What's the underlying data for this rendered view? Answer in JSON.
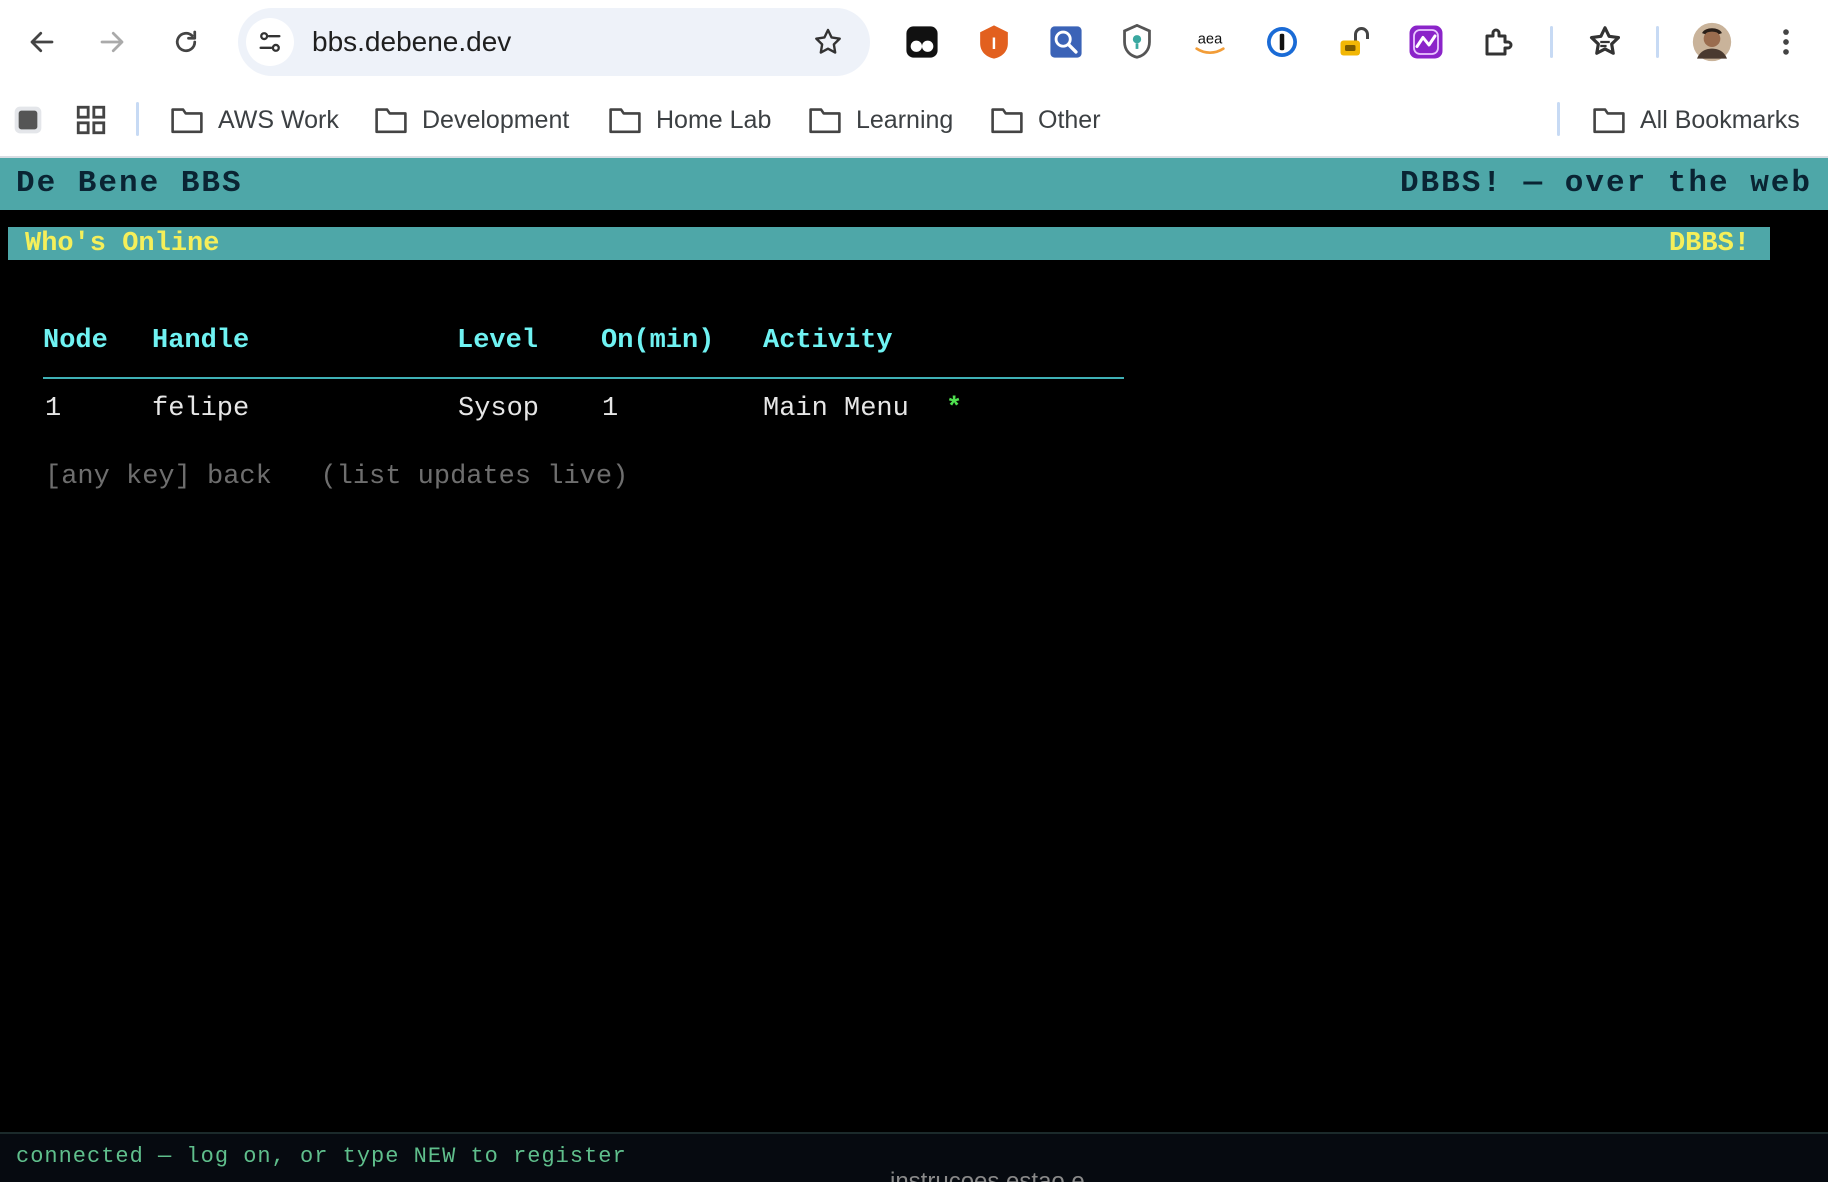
{
  "browser": {
    "url": "bbs.debene.dev",
    "extensions": [
      "tampermonkey-icon",
      "ublock-icon",
      "search-extension-icon",
      "privacy-badger-icon",
      "amazon-assistant-icon",
      "1password-icon",
      "password-unlock-icon",
      "purple-extension-icon",
      "extensions-puzzle-icon",
      "reading-list-icon",
      "profile-avatar-icon",
      "chrome-menu-icon"
    ],
    "extension_labels": {
      "ublock": "I",
      "amazon": "aea"
    }
  },
  "bookmarks": {
    "items": [
      {
        "label": "AWS Work"
      },
      {
        "label": "Development"
      },
      {
        "label": "Home Lab"
      },
      {
        "label": "Learning"
      },
      {
        "label": "Other"
      }
    ],
    "all_bookmarks": "All Bookmarks"
  },
  "terminal": {
    "title_left": "De Bene BBS",
    "title_right": "DBBS! — over the web",
    "screen_title": "Who's Online",
    "screen_brand": "DBBS!",
    "columns": [
      "Node",
      "Handle",
      "Level",
      "On(min)",
      "Activity"
    ],
    "rows": [
      {
        "node": "1",
        "handle": "felipe",
        "level": "Sysop",
        "on_min": "1",
        "activity": "Main Menu",
        "marker": "*"
      }
    ],
    "hint": "[any key] back   (list updates live)",
    "status": "connected — log on, or type NEW to register",
    "underlying_text": "instrucoes estao e"
  },
  "colors": {
    "bar_teal": "#4ea7a8",
    "header_cyan": "#6ff2f2",
    "title_yellow": "#f5ef5a",
    "status_green": "#5fbf8c",
    "marker_green": "#4fe04f"
  }
}
